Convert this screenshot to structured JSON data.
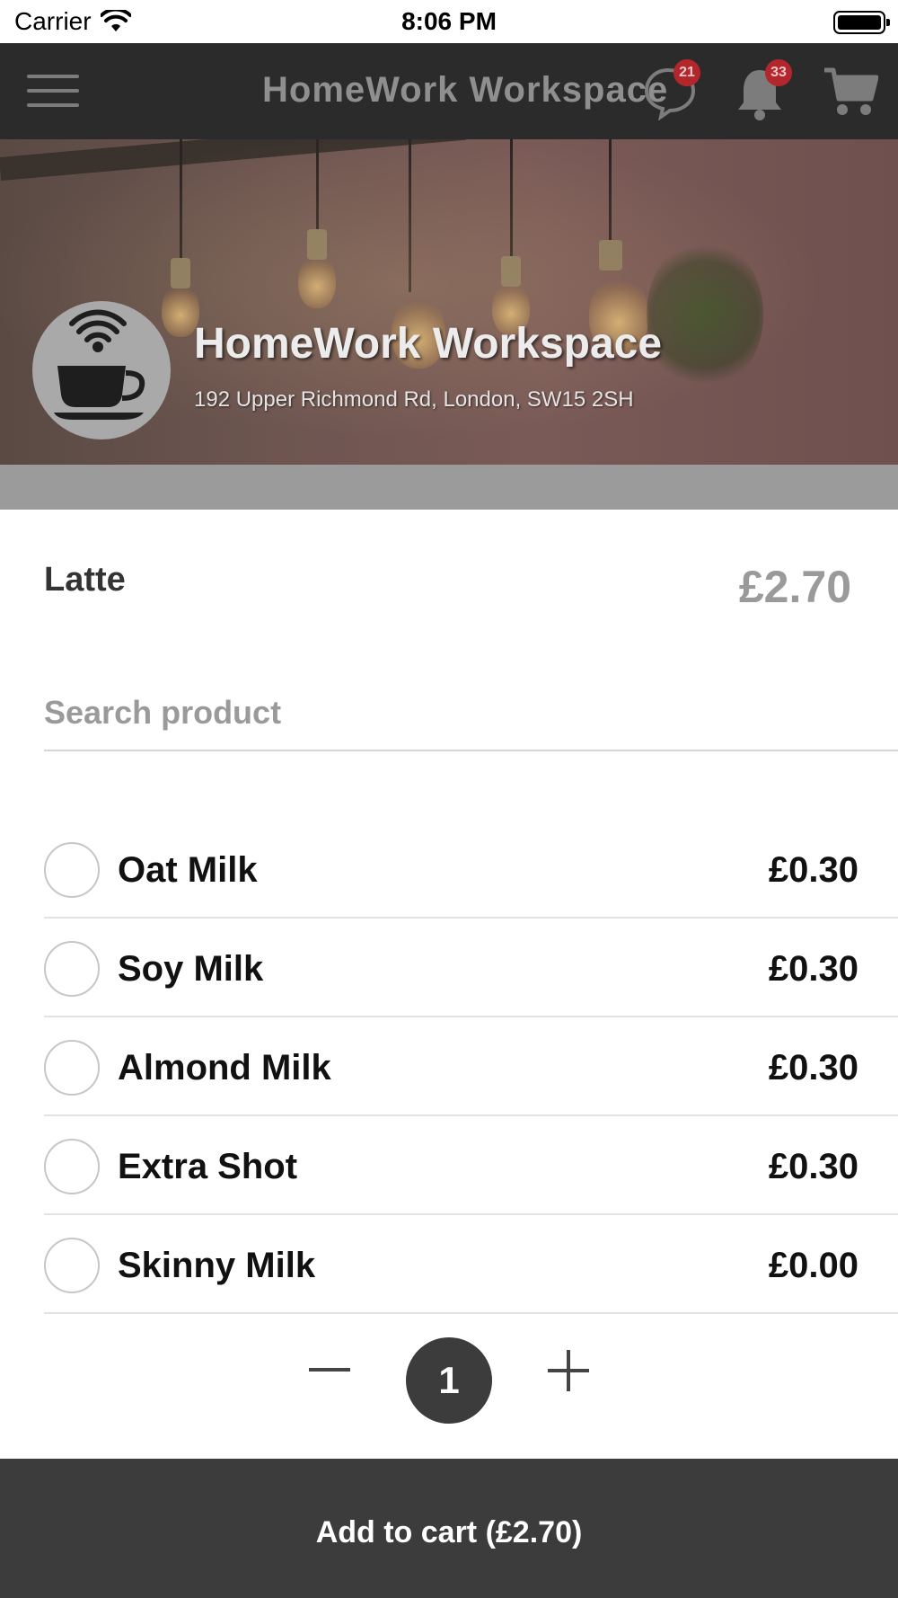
{
  "status_bar": {
    "carrier": "Carrier",
    "time": "8:06 PM"
  },
  "nav": {
    "title": "HomeWork Workspace",
    "chat_badge": "21",
    "notification_badge": "33"
  },
  "venue": {
    "name": "HomeWork Workspace",
    "address": "192 Upper Richmond Rd, London, SW15 2SH"
  },
  "product": {
    "name": "Latte",
    "price": "£2.70"
  },
  "search": {
    "placeholder": "Search product",
    "value": ""
  },
  "options": [
    {
      "label": "Oat Milk",
      "price": "£0.30",
      "selected": false
    },
    {
      "label": "Soy Milk",
      "price": "£0.30",
      "selected": false
    },
    {
      "label": "Almond Milk",
      "price": "£0.30",
      "selected": false
    },
    {
      "label": "Extra Shot",
      "price": "£0.30",
      "selected": false
    },
    {
      "label": "Skinny Milk",
      "price": "£0.00",
      "selected": false
    }
  ],
  "quantity": {
    "value": "1"
  },
  "cart_button": {
    "label": "Add to cart (£2.70)"
  },
  "colors": {
    "nav_bg": "#2b2b2b",
    "badge": "#b3262b",
    "button_bg": "#3d3c3d"
  }
}
